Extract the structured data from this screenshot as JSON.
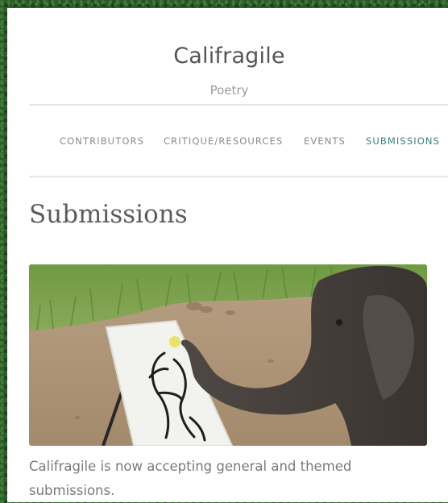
{
  "site": {
    "title": "Califragile",
    "tagline": "Poetry"
  },
  "nav": {
    "items": [
      {
        "label": "CONTRIBUTORS"
      },
      {
        "label": "CRITIQUE/RESOURCES"
      },
      {
        "label": "EVENTS"
      },
      {
        "label": "SUBMISSIONS"
      }
    ],
    "active_index": 3
  },
  "page": {
    "heading": "Submissions",
    "body": "Califragile is now accepting general and themed submissions."
  },
  "image": {
    "subject": "elephant-painting-on-easel"
  },
  "colors": {
    "accent": "#3a7f86",
    "nav_text": "#8a8a8a",
    "heading": "#5c5c5c",
    "background_pattern": "#2f5a2c"
  }
}
